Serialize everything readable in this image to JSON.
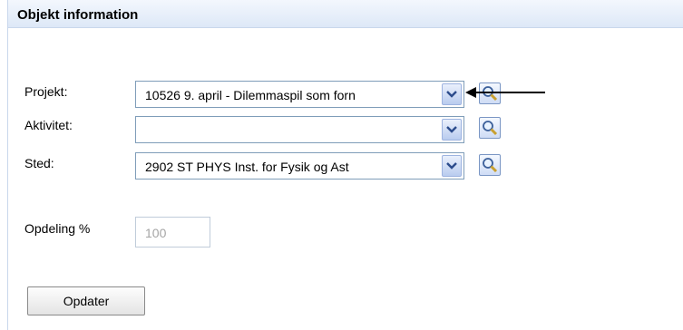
{
  "panel": {
    "title": "Objekt information"
  },
  "fields": {
    "projekt": {
      "label": "Projekt:",
      "value": "10526 9. april - Dilemmaspil som forn"
    },
    "aktivitet": {
      "label": "Aktivitet:",
      "value": ""
    },
    "sted": {
      "label": "Sted:",
      "value": "2902 ST PHYS Inst. for Fysik og Ast"
    },
    "opdeling": {
      "label": "Opdeling %",
      "value": "100"
    }
  },
  "buttons": {
    "update_label": "Opdater"
  },
  "icons": {
    "search": "magnifier-icon",
    "dropdown": "chevron-down-icon",
    "pointer": "arrow-left-icon"
  },
  "colors": {
    "header_bg": "#dde8f7",
    "border": "#7f9db9",
    "dropdown": "#b9ccef"
  }
}
